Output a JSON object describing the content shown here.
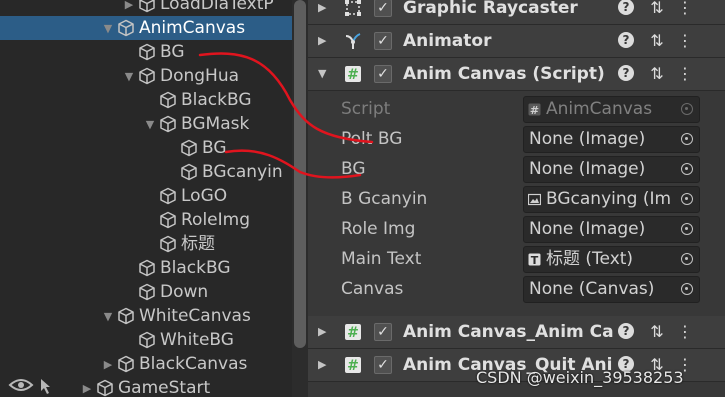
{
  "hierarchy": {
    "items": [
      {
        "label": "LoadDiaTextP",
        "depth": 2,
        "arrow": "right",
        "selected": false
      },
      {
        "label": "AnimCanvas",
        "depth": 1,
        "arrow": "down",
        "selected": true
      },
      {
        "label": "BG",
        "depth": 2,
        "arrow": "none",
        "selected": false
      },
      {
        "label": "DongHua",
        "depth": 2,
        "arrow": "down",
        "selected": false
      },
      {
        "label": "BlackBG",
        "depth": 3,
        "arrow": "none",
        "selected": false
      },
      {
        "label": "BGMask",
        "depth": 3,
        "arrow": "down",
        "selected": false
      },
      {
        "label": "BG",
        "depth": 4,
        "arrow": "none",
        "selected": false
      },
      {
        "label": "BGcanyin",
        "depth": 4,
        "arrow": "none",
        "selected": false
      },
      {
        "label": "LoGO",
        "depth": 3,
        "arrow": "none",
        "selected": false
      },
      {
        "label": "RoleImg",
        "depth": 3,
        "arrow": "none",
        "selected": false
      },
      {
        "label": "标题",
        "depth": 3,
        "arrow": "none",
        "selected": false
      },
      {
        "label": "BlackBG",
        "depth": 2,
        "arrow": "none",
        "selected": false
      },
      {
        "label": "Down",
        "depth": 2,
        "arrow": "none",
        "selected": false
      },
      {
        "label": "WhiteCanvas",
        "depth": 1,
        "arrow": "down",
        "selected": false
      },
      {
        "label": "WhiteBG",
        "depth": 2,
        "arrow": "none",
        "selected": false
      },
      {
        "label": "BlackCanvas",
        "depth": 1,
        "arrow": "right",
        "selected": false
      },
      {
        "label": "GameStart",
        "depth": 0,
        "arrow": "right",
        "selected": false
      }
    ]
  },
  "inspector": {
    "components": [
      {
        "title": "Graphic Raycaster",
        "arrow": "right",
        "icon": "graphic-raycaster-icon",
        "enabled": true
      },
      {
        "title": "Animator",
        "arrow": "right",
        "icon": "animator-icon",
        "enabled": true
      },
      {
        "title": "Anim Canvas (Script)",
        "arrow": "down",
        "icon": "script-icon",
        "enabled": true
      }
    ],
    "fields": [
      {
        "label": "Script",
        "value": "AnimCanvas",
        "icon": "script-icon",
        "disabled": true
      },
      {
        "label": "Polt BG",
        "value": "None (Image)",
        "icon": "",
        "disabled": false
      },
      {
        "label": "BG",
        "value": "None (Image)",
        "icon": "",
        "disabled": false
      },
      {
        "label": "B Gcanyin",
        "value": "BGcanying (Im",
        "icon": "image-icon",
        "disabled": false
      },
      {
        "label": "Role Img",
        "value": "None (Image)",
        "icon": "",
        "disabled": false
      },
      {
        "label": "Main Text",
        "value": "标题 (Text)",
        "icon": "text-icon",
        "disabled": false
      },
      {
        "label": "Canvas",
        "value": "None (Canvas)",
        "icon": "",
        "disabled": false
      }
    ],
    "bottom_components": [
      {
        "title": "Anim Canvas_Anim Ca",
        "arrow": "right",
        "icon": "script-icon",
        "enabled": true
      },
      {
        "title": "Anim Canvas_Quit Ani",
        "arrow": "right",
        "icon": "script-icon",
        "enabled": true
      }
    ]
  },
  "watermark": "CSDN @weixin_39538253",
  "colors": {
    "hierarchy_bg": "#282828",
    "inspector_bg": "#383838",
    "selection": "#2c5d87",
    "annotation": "#e0141e",
    "script_icon": "#4caf50"
  }
}
